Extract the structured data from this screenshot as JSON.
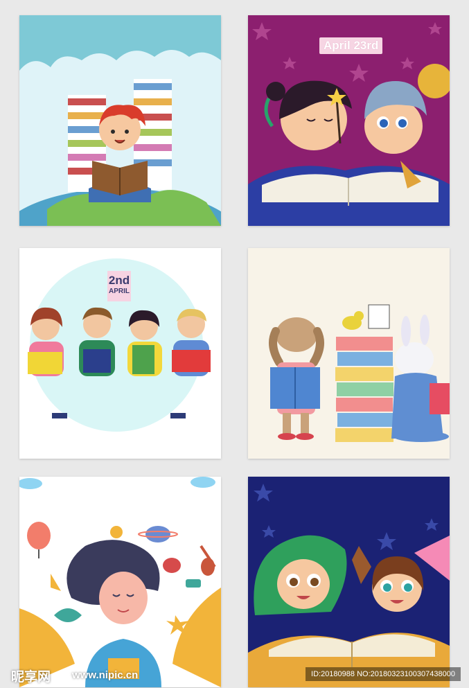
{
  "cards": {
    "c1": {
      "subject": "boy-reading-on-globe"
    },
    "c2": {
      "badge": "April 23rd",
      "subject": "kids-reading-with-wand"
    },
    "c3": {
      "day": "2nd",
      "month": "APRIL",
      "subject": "kids-holding-puzzle-pieces"
    },
    "c4": {
      "subject": "dog-and-rabbit-reading"
    },
    "c5": {
      "subject": "girl-with-floating-objects"
    },
    "c6": {
      "subject": "kids-in-costumes-reading"
    }
  },
  "watermark": {
    "logo": "昵享网",
    "url": "www.nipic.cn",
    "id_text": "ID:20180988 NO:20180323100307438000"
  },
  "colors": {
    "page_bg": "#e9e9e9",
    "card2_bg": "#8c1f6f",
    "card6_bg": "#1b2274"
  }
}
